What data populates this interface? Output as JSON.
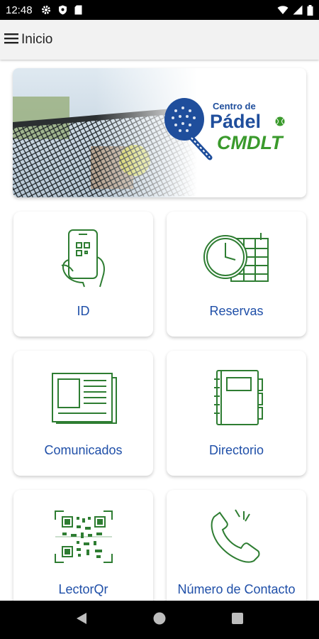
{
  "status_bar": {
    "time": "12:48"
  },
  "app_bar": {
    "title": "Inicio",
    "menu_icon": "hamburger-icon"
  },
  "banner": {
    "logo_line1": "Centro de",
    "logo_line2": "Pádel",
    "logo_line3": "CMDLT"
  },
  "tiles": [
    {
      "label": "ID",
      "icon": "phone-qr-icon"
    },
    {
      "label": "Reservas",
      "icon": "clock-calendar-icon"
    },
    {
      "label": "Comunicados",
      "icon": "newspaper-icon"
    },
    {
      "label": "Directorio",
      "icon": "notebook-icon"
    },
    {
      "label": "LectorQr",
      "icon": "qr-scan-icon"
    },
    {
      "label": "Número de Contacto",
      "icon": "phone-call-icon"
    }
  ],
  "colors": {
    "accent_blue": "#1f4fa8",
    "icon_green": "#2e7d32",
    "logo_green": "#3a9a2c"
  }
}
